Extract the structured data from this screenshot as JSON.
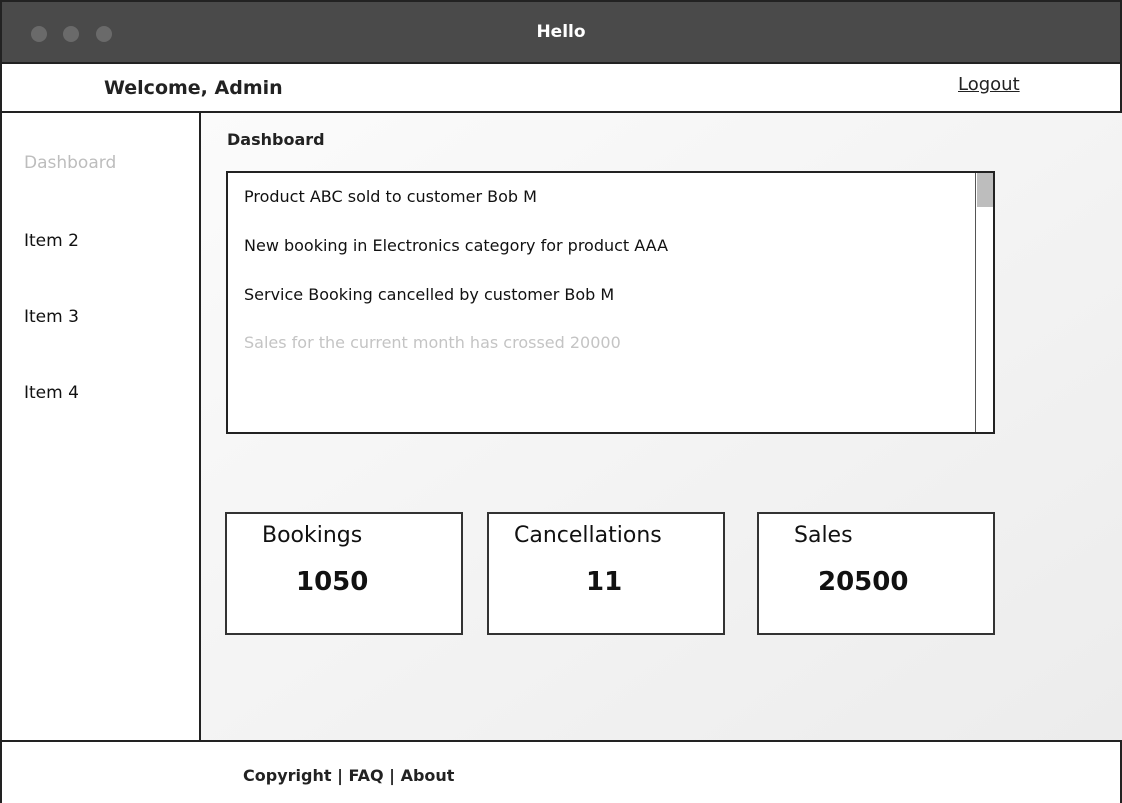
{
  "window": {
    "title": "Hello"
  },
  "header": {
    "welcome": "Welcome, Admin",
    "logout_label": "Logout"
  },
  "sidebar": {
    "items": [
      {
        "label": "Dashboard",
        "active": true
      },
      {
        "label": "Item 2"
      },
      {
        "label": "Item 3"
      },
      {
        "label": "Item 4"
      }
    ]
  },
  "main": {
    "title": "Dashboard",
    "activity": [
      "Product ABC sold to customer Bob M",
      "New booking in Electronics category for product AAA",
      "Service Booking cancelled by customer Bob M",
      "Sales for the current month has crossed 20000"
    ],
    "cards": [
      {
        "label": "Bookings",
        "value": "1050"
      },
      {
        "label": "Cancellations",
        "value": "11"
      },
      {
        "label": "Sales",
        "value": "20500"
      }
    ]
  },
  "footer": {
    "copyright": "Copyright",
    "sep": "|",
    "faq": "FAQ",
    "about": "About"
  }
}
